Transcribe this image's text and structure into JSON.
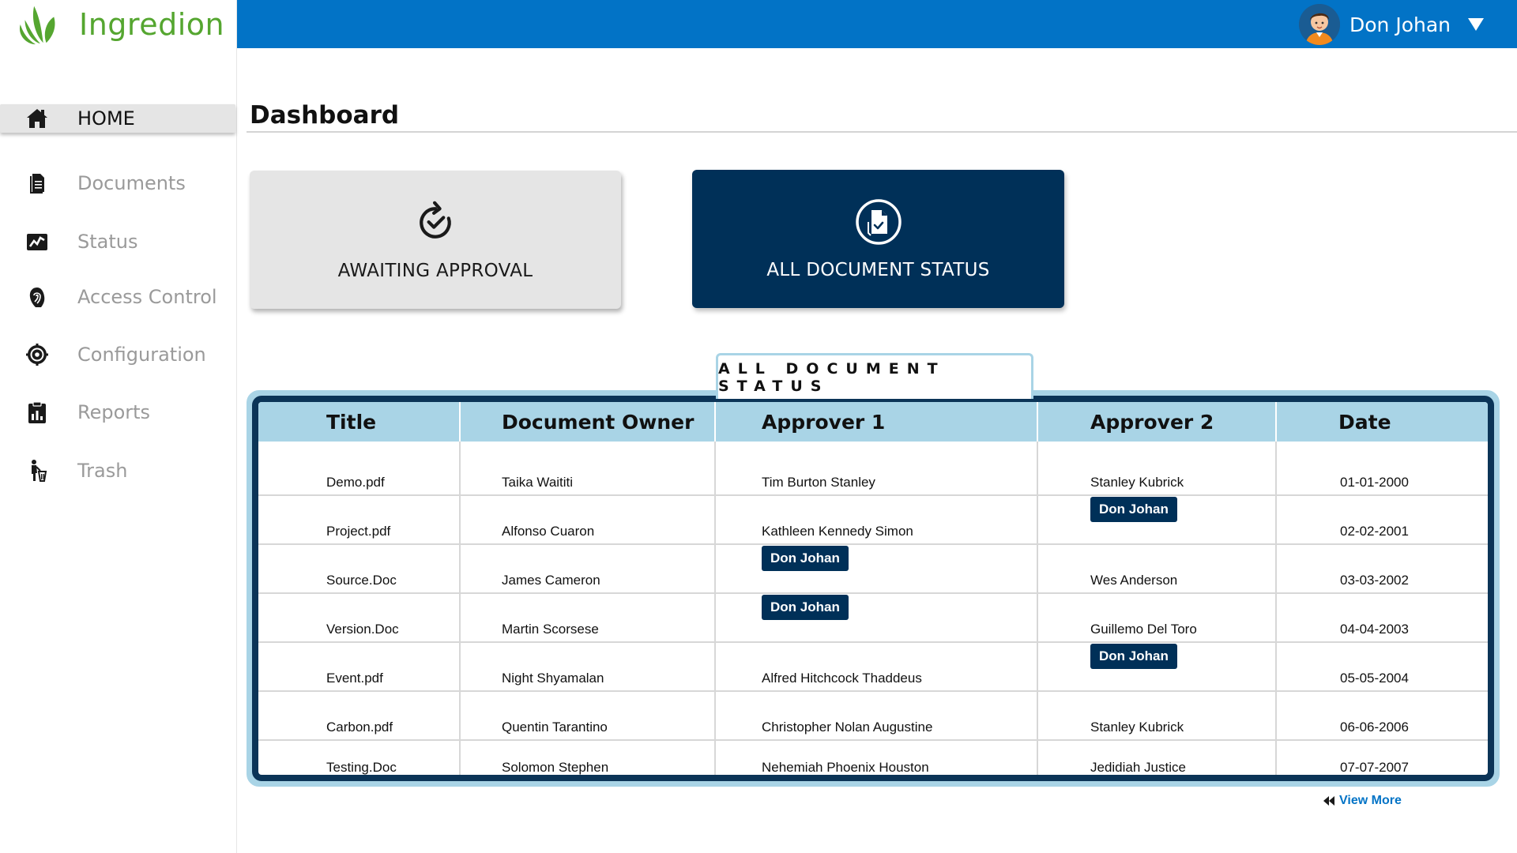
{
  "app": {
    "name": "Ingredion"
  },
  "colors": {
    "topbar": "#0273c6",
    "navy": "#003058",
    "table_header": "#a9d4e6",
    "logo_green": "#55a630"
  },
  "user": {
    "name": "Don Johan"
  },
  "sidebar": {
    "items": [
      {
        "label": "HOME",
        "icon": "home-icon",
        "active": true
      },
      {
        "label": "Documents",
        "icon": "document-icon"
      },
      {
        "label": "Status",
        "icon": "chart-line-icon"
      },
      {
        "label": "Access Control",
        "icon": "fingerprint-icon"
      },
      {
        "label": "Configuration",
        "icon": "gear-icon"
      },
      {
        "label": "Reports",
        "icon": "clipboard-icon"
      },
      {
        "label": "Trash",
        "icon": "trash-person-icon"
      }
    ]
  },
  "page": {
    "title": "Dashboard"
  },
  "cards": {
    "awaiting": {
      "label": "AWAITING APPROVAL",
      "icon": "refresh-check-icon"
    },
    "all": {
      "label": "ALL DOCUMENT STATUS",
      "icon": "document-check-icon"
    }
  },
  "table": {
    "tab_label": "ALL DOCUMENT STATUS",
    "columns": [
      "Title",
      "Document Owner",
      "Approver 1",
      "Approver 2",
      "Date"
    ],
    "rows": [
      {
        "title": "Demo.pdf",
        "owner": "Taika Waititi",
        "approver1": "Tim Burton Stanley",
        "approver2": "Stanley Kubrick",
        "date": "01-01-2000"
      },
      {
        "title": "Project.pdf",
        "owner": "Alfonso Cuaron",
        "approver1": "Kathleen Kennedy Simon",
        "approver2": "Don Johan",
        "date": "02-02-2001"
      },
      {
        "title": "Source.Doc",
        "owner": "James Cameron",
        "approver1": "Don Johan",
        "approver2": "Wes Anderson",
        "date": "03-03-2002"
      },
      {
        "title": "Version.Doc",
        "owner": "Martin Scorsese",
        "approver1": "Don Johan",
        "approver2": "Guillemo Del Toro",
        "date": "04-04-2003"
      },
      {
        "title": "Event.pdf",
        "owner": "Night Shyamalan",
        "approver1": "Alfred Hitchcock Thaddeus",
        "approver2": "Don Johan",
        "date": "05-05-2004"
      },
      {
        "title": "Carbon.pdf",
        "owner": "Quentin Tarantino",
        "approver1": "Christopher Nolan Augustine",
        "approver2": "Stanley Kubrick",
        "date": "06-06-2006"
      },
      {
        "title": "Testing.Doc",
        "owner": "Solomon Stephen",
        "approver1": "Nehemiah Phoenix Houston",
        "approver2": "Jedidiah Justice",
        "date": "07-07-2007"
      }
    ],
    "view_more": "View More"
  }
}
